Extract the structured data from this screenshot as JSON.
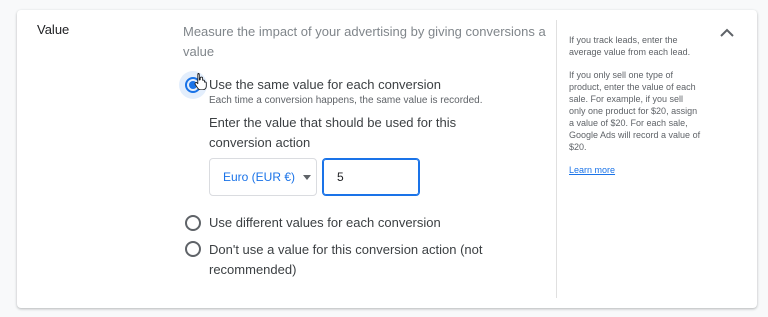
{
  "section": {
    "title": "Value",
    "description": "Measure the impact of your advertising by giving conversions a value"
  },
  "options": [
    {
      "label": "Use the same value for each conversion",
      "sublabel": "Each time a conversion happens, the same value is recorded.",
      "selected": true
    },
    {
      "label": "Use different values for each conversion",
      "selected": false
    },
    {
      "label": "Don't use a value for this conversion action (not recommended)",
      "selected": false
    }
  ],
  "value_prompt": "Enter the value that should be used for this conversion action",
  "currency": {
    "selected": "Euro (EUR €)",
    "icon": "dropdown-caret"
  },
  "value_input": {
    "value": "5"
  },
  "help": {
    "paragraph1": "If you track leads, enter the average value from each lead.",
    "paragraph2": "If you only sell one type of product, enter the value of each sale. For example, if you sell only one product for $20, assign a value of $20. For each sale, Google Ads will record a value of $20.",
    "learn_more": "Learn more"
  },
  "icons": {
    "collapse": "chevron-up-icon",
    "cursor": "hand-pointer-icon"
  },
  "colors": {
    "accent": "#1a73e8",
    "text": "#3c4043",
    "muted": "#80868b",
    "border": "#dadce0"
  }
}
